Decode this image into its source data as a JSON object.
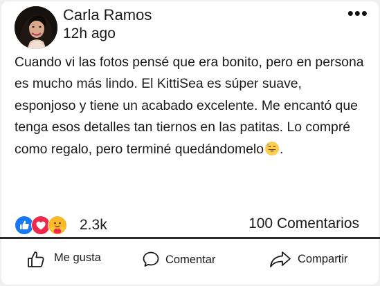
{
  "post": {
    "author": "Carla Ramos",
    "time": "12h ago",
    "text": "Cuando vi las fotos pensé que era bonito, pero en persona es mucho más lindo. El KittiSea es súper suave, esponjoso y tiene un acabado excelente. Me encantó que tenga esos detalles tan tiernos en las patitas. Lo compré como regalo, pero terminé quedándomelo",
    "text_end": ".",
    "emoji": "grinning-face-with-sweat-emoji",
    "more_icon": "more-options-icon"
  },
  "reactions": {
    "icons": [
      "like-reaction-icon",
      "love-reaction-icon",
      "care-reaction-icon"
    ],
    "count": "2.3k",
    "comments": "100 Comentarios"
  },
  "actions": {
    "like": "Me gusta",
    "comment": "Comentar",
    "share": "Compartir"
  },
  "colors": {
    "like_blue": "#1877f2",
    "love_red": "#f02849",
    "care_yellow": "#f7b928",
    "divider": "#2a2a2a"
  }
}
